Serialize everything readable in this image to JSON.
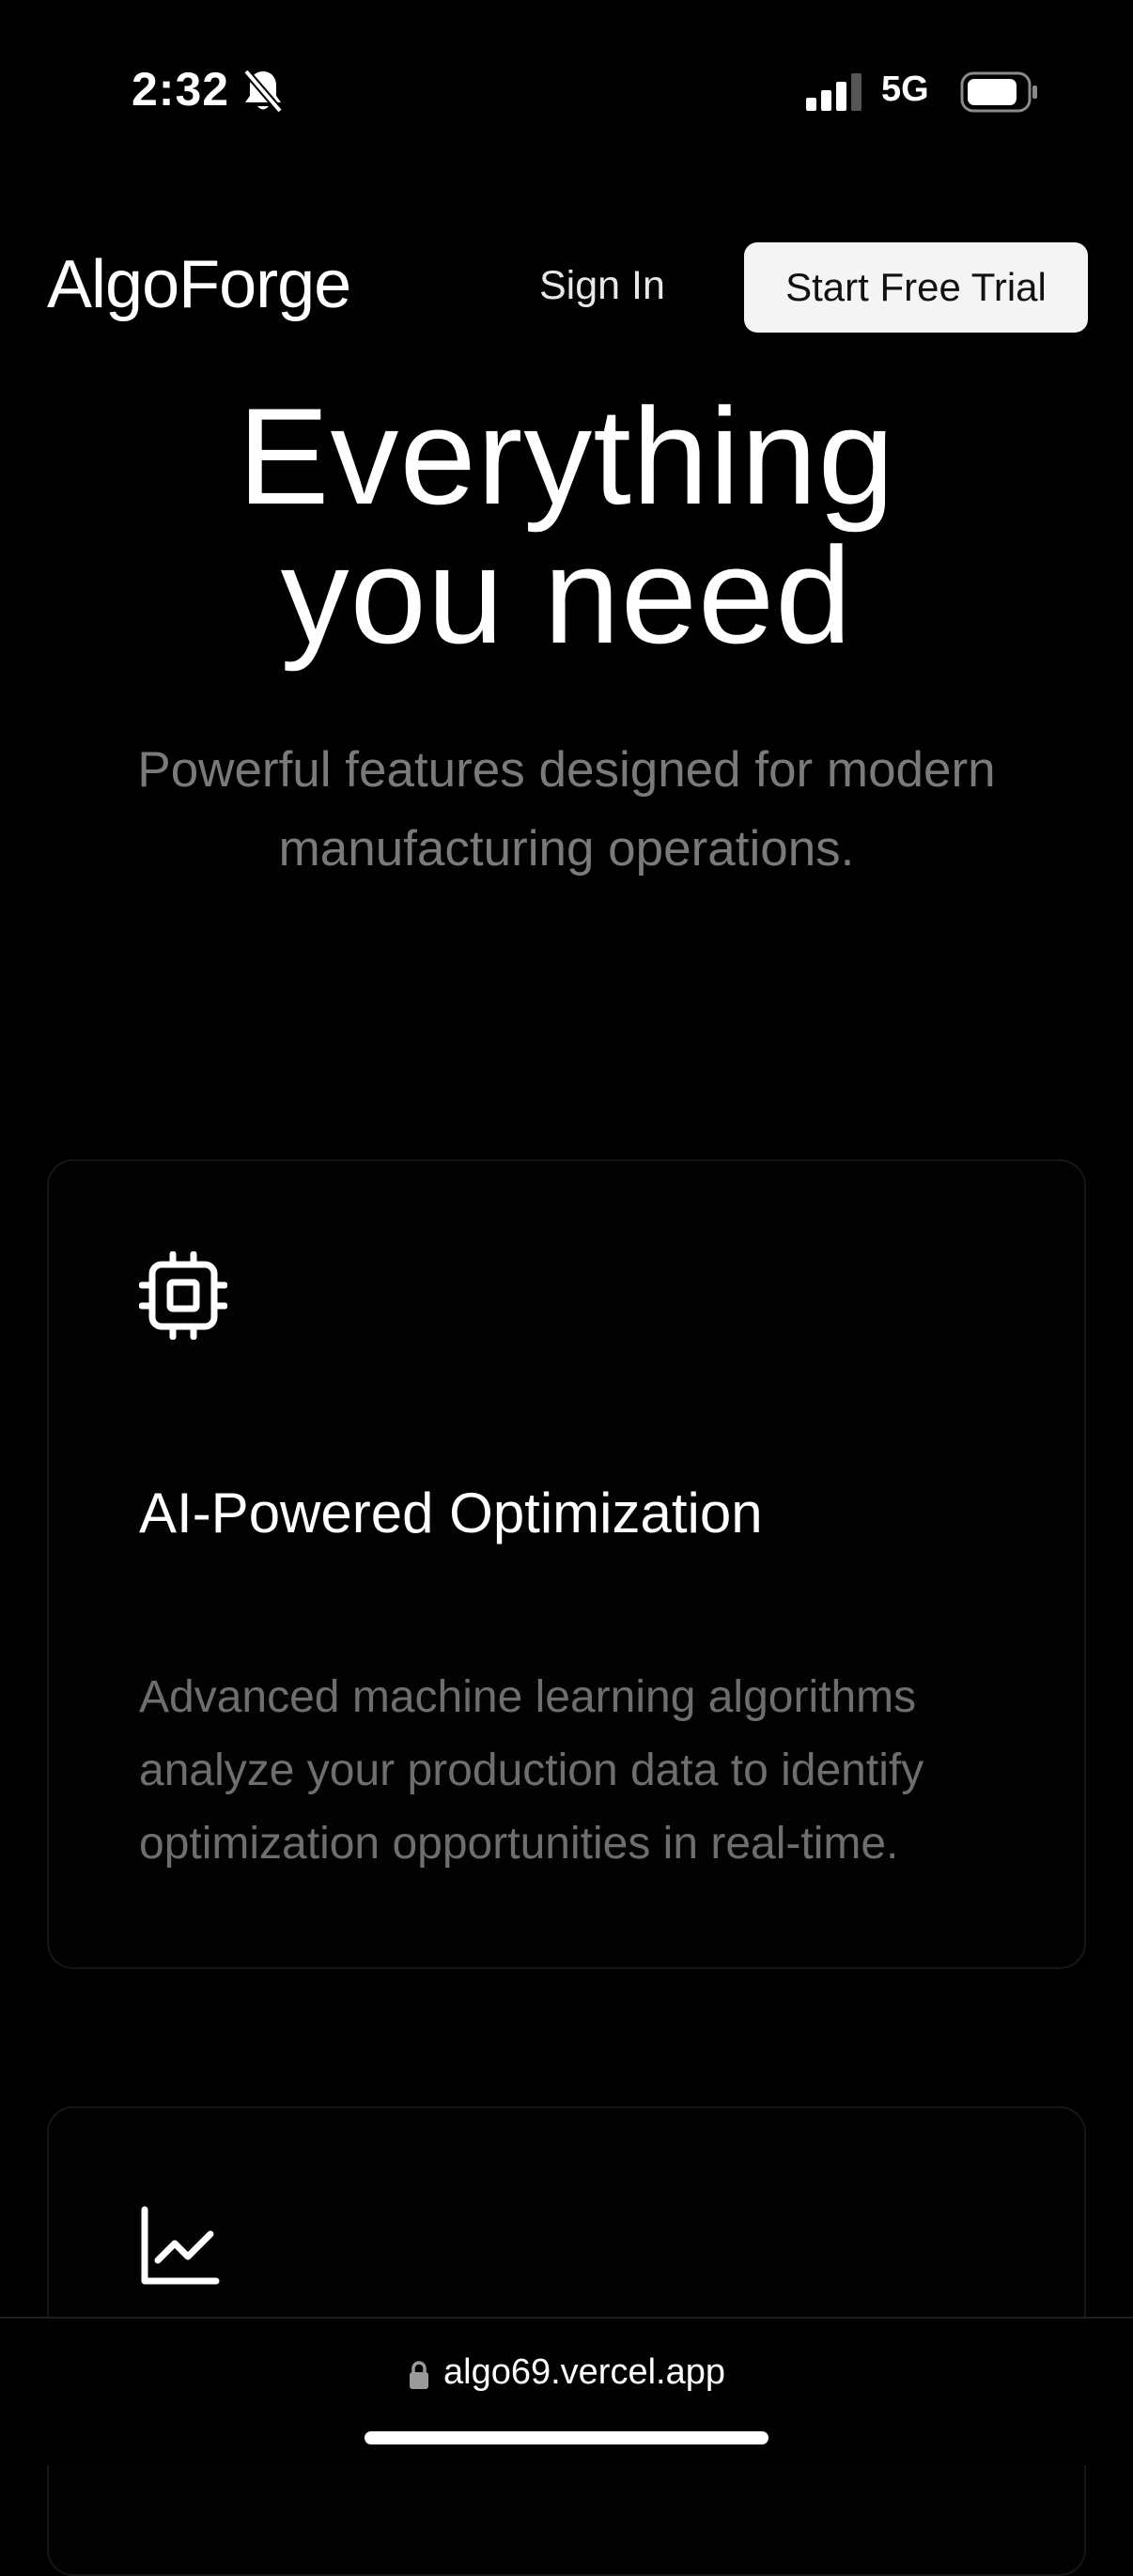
{
  "status_bar": {
    "time": "2:32",
    "network": "5G",
    "icons": [
      "bell-slash-icon",
      "signal-icon",
      "battery-icon"
    ]
  },
  "header": {
    "brand": "AlgoForge",
    "sign_in_label": "Sign In",
    "trial_button_label": "Start Free Trial"
  },
  "hero": {
    "title_line_1": "Everything",
    "title_line_2": "you need",
    "subtitle": "Powerful features designed for modern manufacturing operations."
  },
  "features": [
    {
      "icon": "cpu-icon",
      "title": "AI-Powered Optimization",
      "description": "Advanced machine learning algorithms analyze your production data to identify optimization opportunities in real-time."
    },
    {
      "icon": "chart-line-icon"
    }
  ],
  "browser": {
    "url": "algo69.vercel.app"
  },
  "colors": {
    "background": "#000000",
    "text_primary": "#ffffff",
    "text_muted": "#7a7a7a",
    "button_bg": "#f4f4f4",
    "card_border": "#161616"
  }
}
